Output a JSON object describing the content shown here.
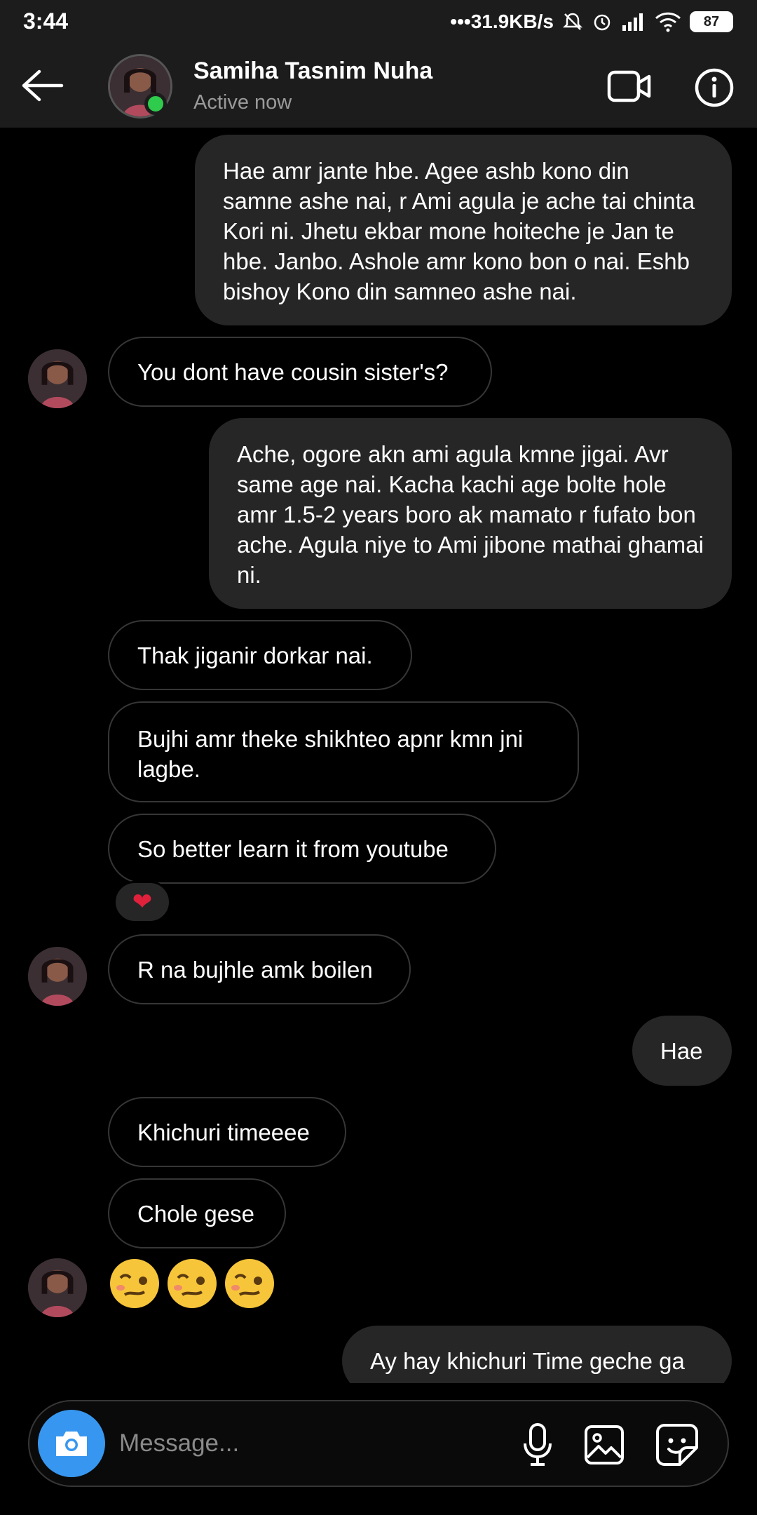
{
  "status_bar": {
    "time": "3:44",
    "network_speed": "•••31.9KB/s",
    "battery": "87"
  },
  "header": {
    "contact_name": "Samiha Tasnim Nuha",
    "status": "Active now"
  },
  "messages": [
    {
      "side": "out",
      "text": "Hae amr jante hbe. Agee ashb kono din samne ashe nai, r Ami agula je ache tai chinta Kori ni. Jhetu ekbar mone hoiteche je Jan te hbe. Janbo. Ashole amr kono bon o nai. Eshb bishoy Kono din samneo ashe nai."
    },
    {
      "side": "in",
      "text": "You dont have cousin sister's?"
    },
    {
      "side": "out",
      "text": "Ache, ogore akn ami agula kmne jigai. Avr same age nai. Kacha kachi age bolte hole amr 1.5-2 years boro ak mamato r fufato bon ache. Agula niye to Ami jibone mathai ghamai ni."
    },
    {
      "side": "in",
      "text": "Thak jiganir dorkar nai."
    },
    {
      "side": "in",
      "text": "Bujhi amr theke shikhteo apnr kmn jni lagbe."
    },
    {
      "side": "in",
      "text": "So better learn it from youtube",
      "reaction": "❤"
    },
    {
      "side": "in",
      "text": "R na bujhle amk boilen"
    },
    {
      "side": "out",
      "text": "Hae"
    },
    {
      "side": "in",
      "text": "Khichuri timeeee"
    },
    {
      "side": "in",
      "text": "Chole gese"
    },
    {
      "side": "in",
      "text": "🥴🥴🥴",
      "emoji_count": 3
    },
    {
      "side": "out",
      "text": "Ay hay khichuri Time geche ga"
    }
  ],
  "composer": {
    "placeholder": "Message..."
  },
  "colors": {
    "accent_blue": "#3797f0",
    "online_green": "#2fcb4c",
    "outgoing_bubble": "#262626",
    "reaction_heart": "#e0213b"
  }
}
